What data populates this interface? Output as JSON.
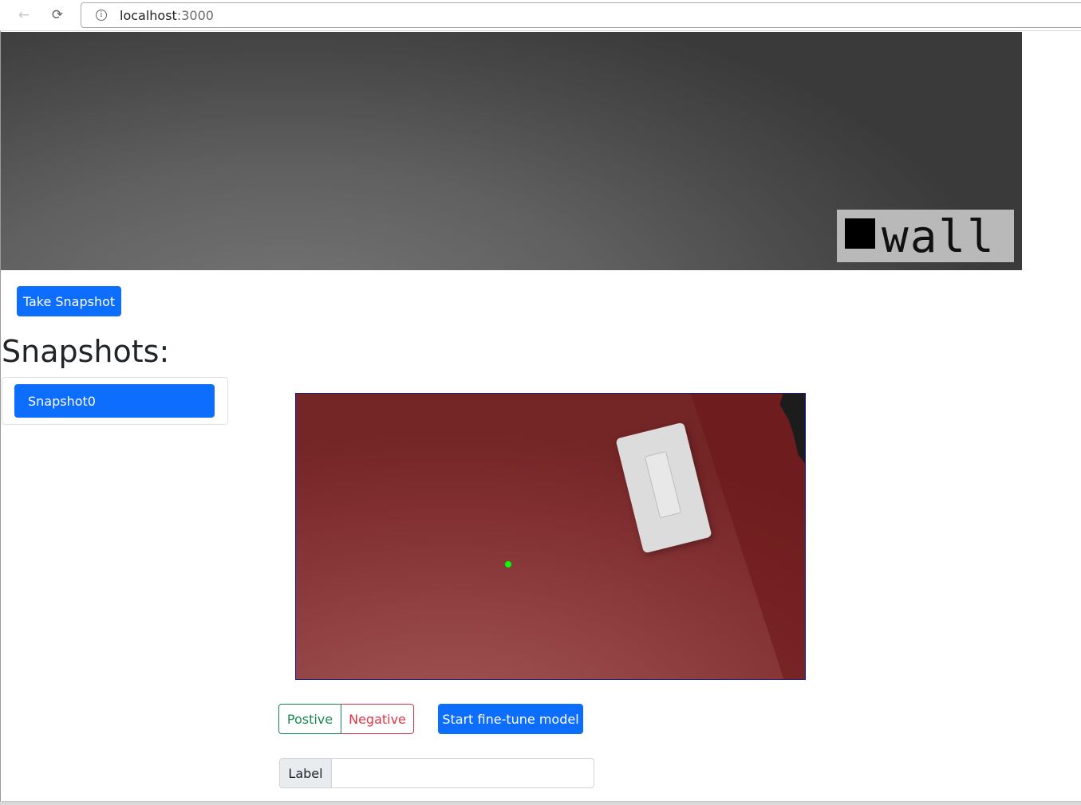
{
  "browser": {
    "back_icon": "arrow-left-icon",
    "reload_icon": "reload-icon",
    "info_icon": "info-icon",
    "url_host": "localhost",
    "url_port": ":3000"
  },
  "camera": {
    "detection_label": "wall",
    "detection_swatch_color": "#000000"
  },
  "actions": {
    "take_snapshot_label": "Take Snapshot",
    "snapshots_heading": "Snapshots:",
    "snapshot_items": [
      {
        "label": "Snapshot0"
      }
    ]
  },
  "labeling": {
    "positive_label": "Postive",
    "negative_label": "Negative",
    "finetune_label": "Start fine-tune model",
    "label_prefix": "Label",
    "label_value": "",
    "click_point_color": "#00ff00"
  },
  "colors": {
    "primary": "#0d6efd",
    "success": "#198754",
    "danger": "#dc3545"
  }
}
